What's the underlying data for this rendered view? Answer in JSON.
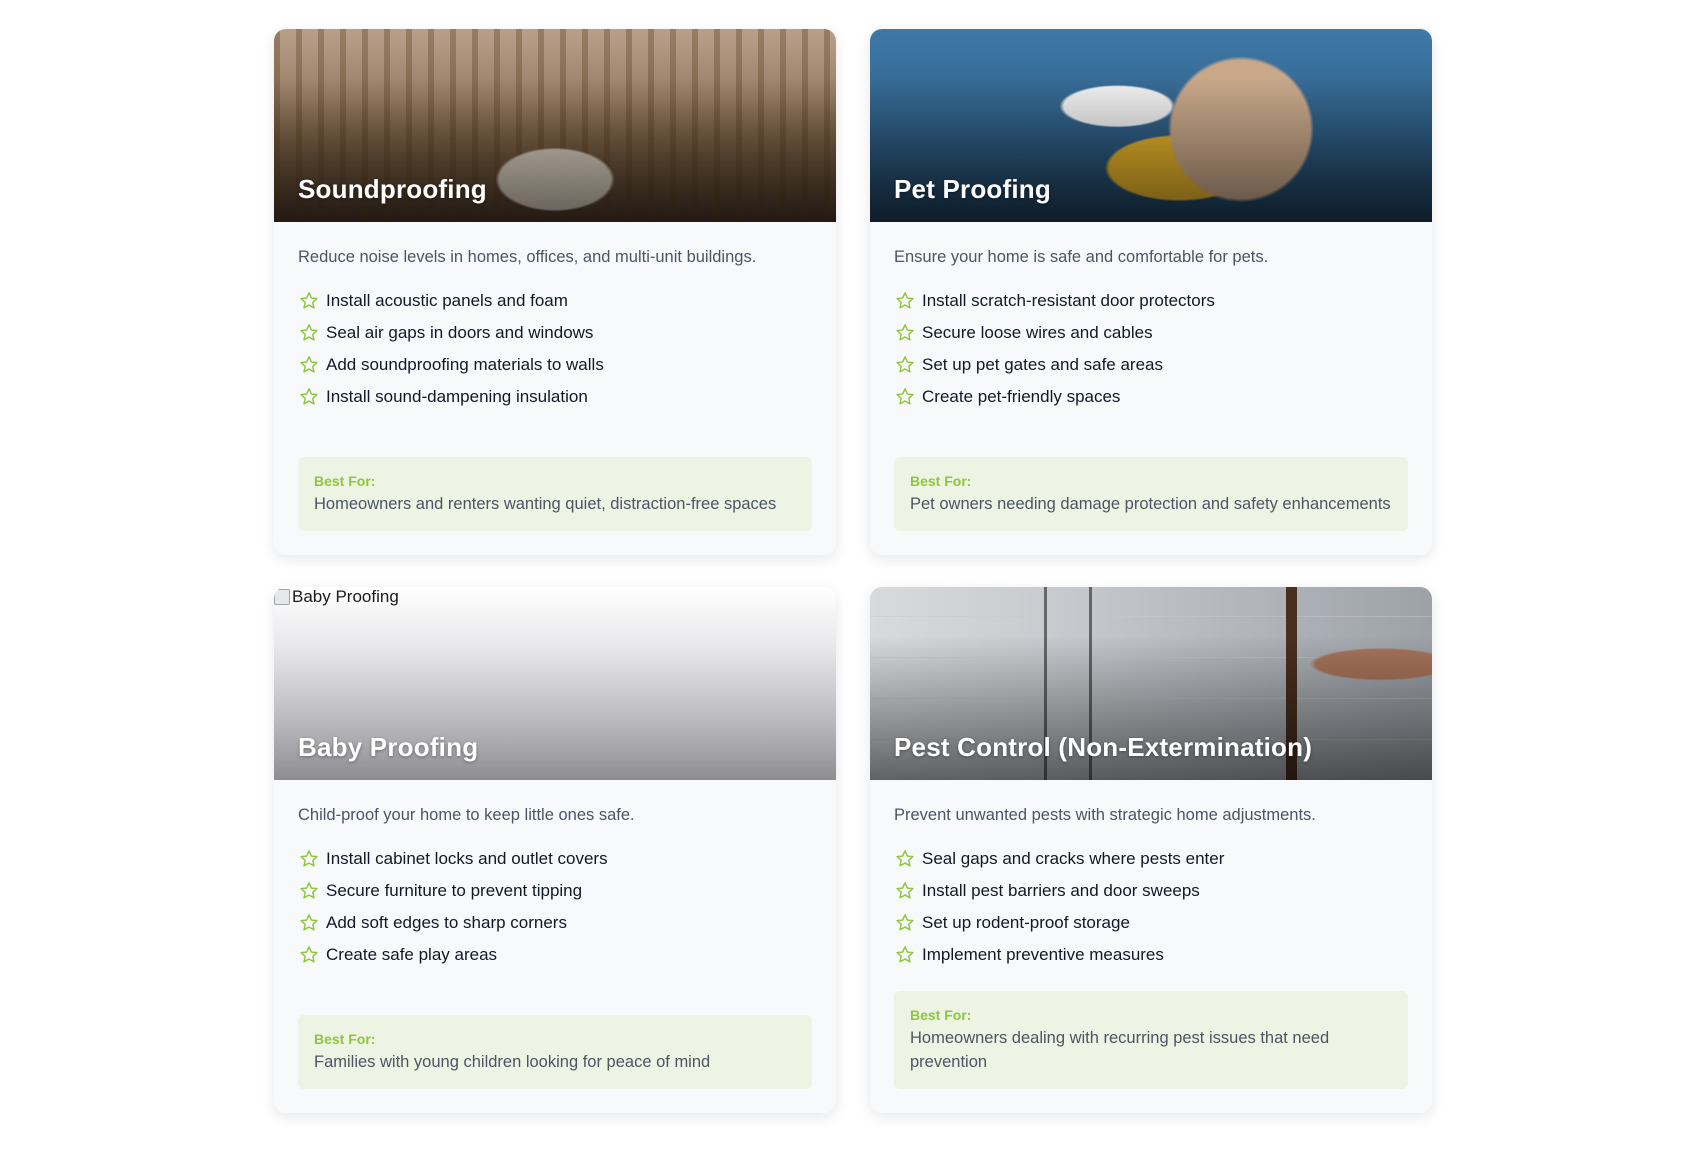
{
  "colors": {
    "accent": "#8dc63f",
    "card_bg": "#f7f9fb",
    "bestfor_bg": "#eef4e4"
  },
  "cards": [
    {
      "title": "Soundproofing",
      "description": "Reduce noise levels in homes, offices, and multi-unit buildings.",
      "features": [
        "Install acoustic panels and foam",
        "Seal air gaps in doors and windows",
        "Add soundproofing materials to walls",
        "Install sound-dampening insulation"
      ],
      "best_for_label": "Best For:",
      "best_for_text": "Homeowners and renters wanting quiet, distraction-free spaces"
    },
    {
      "title": "Pet Proofing",
      "description": "Ensure your home is safe and comfortable for pets.",
      "features": [
        "Install scratch-resistant door protectors",
        "Secure loose wires and cables",
        "Set up pet gates and safe areas",
        "Create pet-friendly spaces"
      ],
      "best_for_label": "Best For:",
      "best_for_text": "Pet owners needing damage protection and safety enhancements"
    },
    {
      "title": "Baby Proofing",
      "image_alt": "Baby Proofing",
      "description": "Child-proof your home to keep little ones safe.",
      "features": [
        "Install cabinet locks and outlet covers",
        "Secure furniture to prevent tipping",
        "Add soft edges to sharp corners",
        "Create safe play areas"
      ],
      "best_for_label": "Best For:",
      "best_for_text": "Families with young children looking for peace of mind"
    },
    {
      "title": "Pest Control (Non-Extermination)",
      "description": "Prevent unwanted pests with strategic home adjustments.",
      "features": [
        "Seal gaps and cracks where pests enter",
        "Install pest barriers and door sweeps",
        "Set up rodent-proof storage",
        "Implement preventive measures"
      ],
      "best_for_label": "Best For:",
      "best_for_text": "Homeowners dealing with recurring pest issues that need prevention"
    }
  ]
}
